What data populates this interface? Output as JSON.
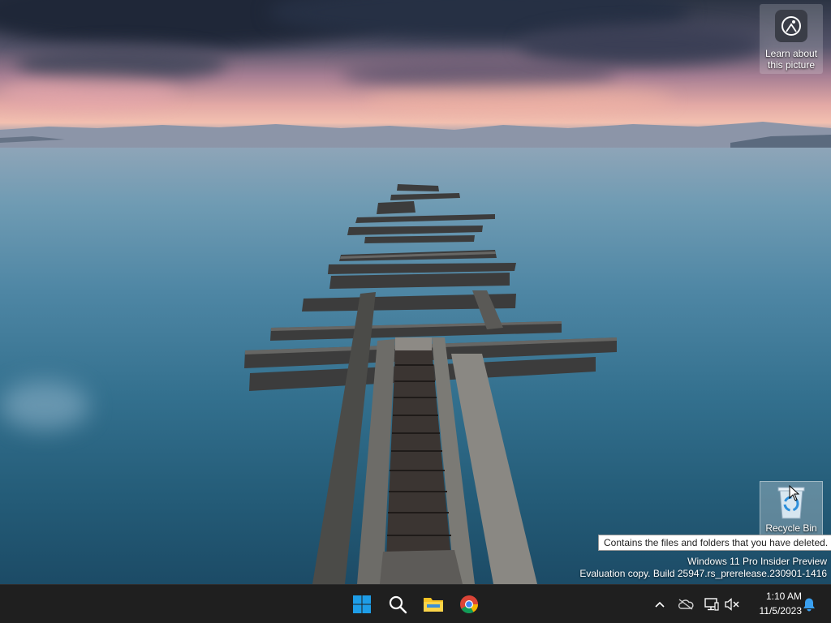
{
  "desktop": {
    "spotlight": {
      "label": "Learn about this picture",
      "icon": "camera-aperture-icon"
    },
    "recycle_bin": {
      "label": "Recycle Bin",
      "icon": "recycle-bin-icon",
      "tooltip": "Contains the files and folders that you have deleted."
    },
    "watermark": {
      "line1": "Windows 11 Pro Insider Preview",
      "line2": "Evaluation copy. Build 25947.rs_prerelease.230901-1416"
    }
  },
  "taskbar": {
    "pinned": [
      {
        "name": "Start",
        "icon": "windows-logo-icon"
      },
      {
        "name": "Search",
        "icon": "search-icon"
      },
      {
        "name": "File Explorer",
        "icon": "folder-icon"
      },
      {
        "name": "Google Chrome",
        "icon": "chrome-icon"
      }
    ],
    "tray": {
      "icons": [
        "chevron-up-icon",
        "onedrive-icon",
        "network-icon",
        "volume-muted-icon",
        "notification-bell-icon"
      ],
      "time": "1:10 AM",
      "date": "11/5/2023"
    }
  },
  "colors": {
    "taskbar_bg": "#1f1f1f",
    "windows_blue": "#1e9de7",
    "folder_yellow": "#f7c325"
  }
}
